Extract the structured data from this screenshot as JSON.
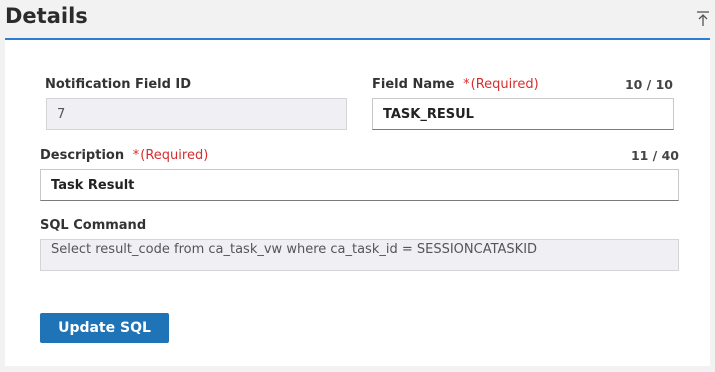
{
  "header": {
    "title": "Details"
  },
  "form": {
    "notification_field_id": {
      "label": "Notification Field ID",
      "value": "7"
    },
    "field_name": {
      "label": "Field Name",
      "required_mark": "*",
      "required_text": "(Required)",
      "counter": "10 / 10",
      "value": "TASK_RESUL"
    },
    "description": {
      "label": "Description",
      "required_mark": "*",
      "required_text": "(Required)",
      "counter": "11 / 40",
      "value": "Task Result"
    },
    "sql_command": {
      "label": "SQL Command",
      "value": "Select result_code from ca_task_vw where ca_task_id = SESSIONCATASKID"
    },
    "update_button": "Update SQL"
  },
  "icons": {
    "collapse": "collapse-to-top-icon"
  },
  "colors": {
    "accent": "#2e7cd6",
    "button": "#1f73b7",
    "required": "#d62e2e",
    "readonly_bg": "#f0f0f4"
  }
}
